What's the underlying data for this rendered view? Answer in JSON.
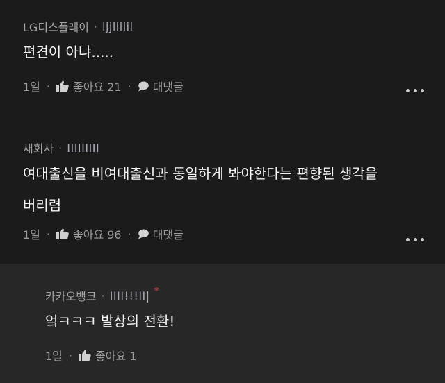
{
  "comments": [
    {
      "author": "LG디스플레이",
      "nickname": "ljjliilil",
      "lines": [
        "편견이 아냐....."
      ],
      "time": "1일",
      "like_label": "좋아요 21",
      "reply_label": "대댓글"
    },
    {
      "author": "새회사",
      "nickname": "IIIIIIIII",
      "lines": [
        "여대출신을 비여대출신과 동일하게 봐야한다는 편향된 생각을",
        "버리렴"
      ],
      "time": "1일",
      "like_label": "좋아요 96",
      "reply_label": "대댓글"
    },
    {
      "author": "카카오뱅크",
      "nickname": "IIII!!!II|",
      "badge": "*",
      "lines": [
        "엌ㅋㅋㅋ 발상의 전환!"
      ],
      "time": "1일",
      "like_label": "좋아요 1"
    }
  ],
  "separator": "·",
  "icons": {
    "like": "thumbs-up-icon",
    "reply": "speech-bubble-icon",
    "more": "more-options-icon"
  },
  "colors": {
    "background": "#1b1b1c",
    "reply_background": "#272728",
    "badge": "#e0403f"
  }
}
